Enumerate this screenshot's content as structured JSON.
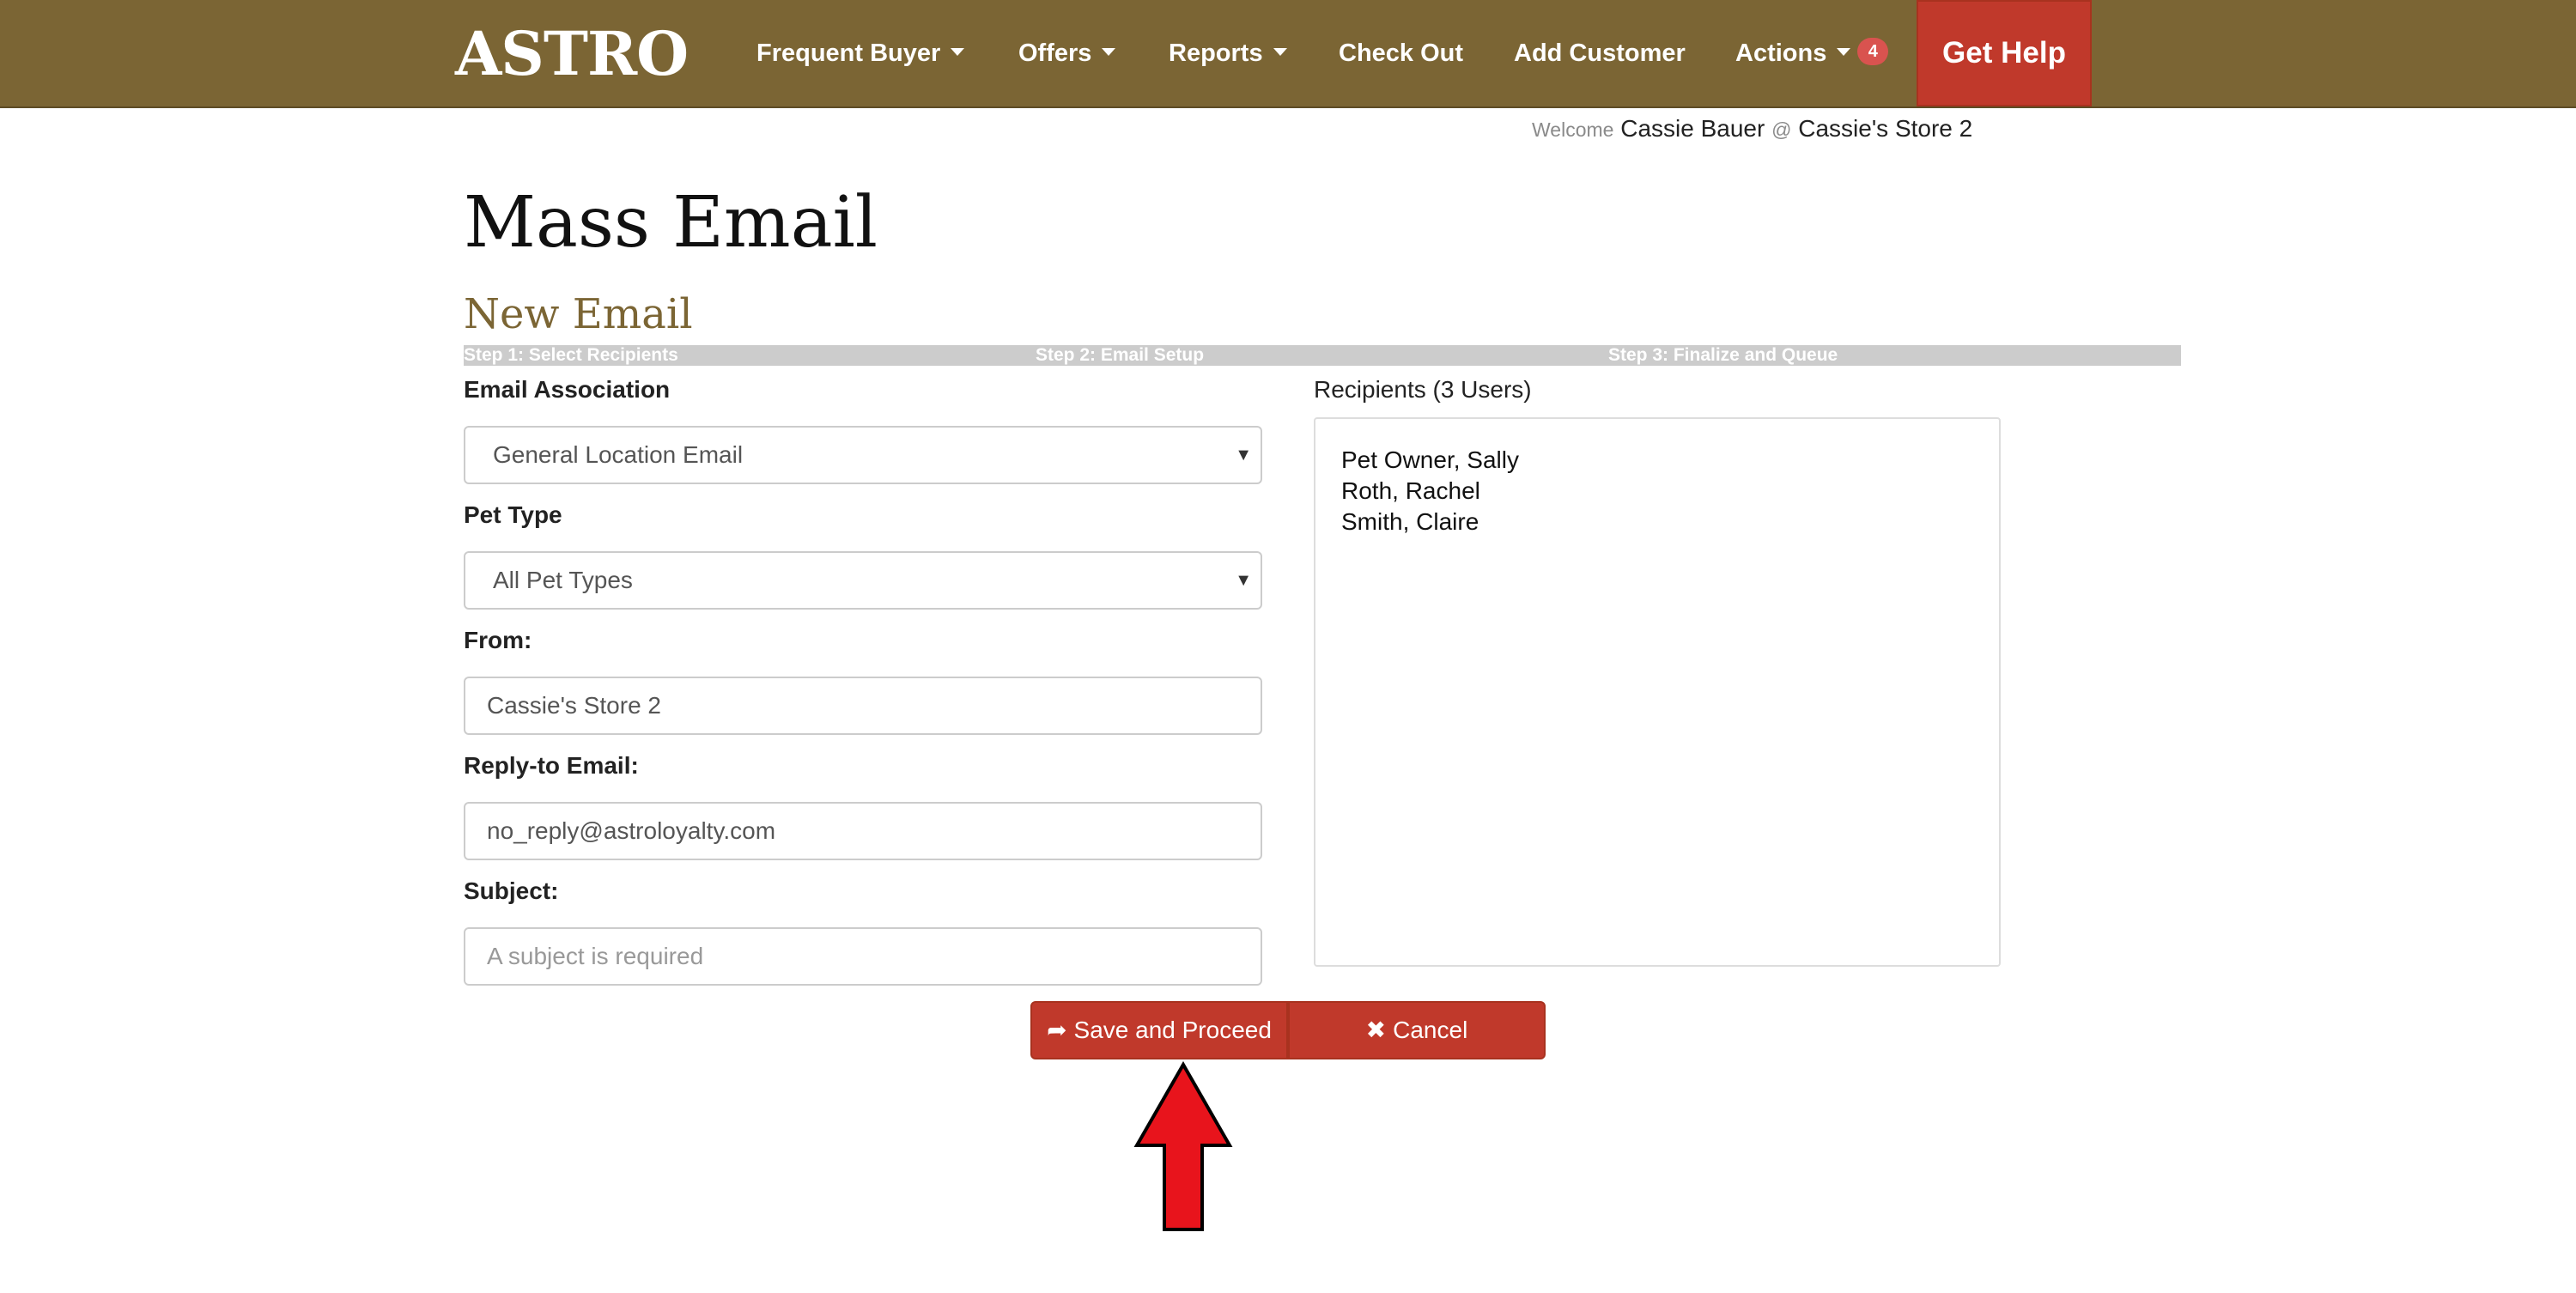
{
  "nav": {
    "brand": "ASTRO",
    "items": [
      {
        "label": "Frequent Buyer",
        "dropdown": true
      },
      {
        "label": "Offers",
        "dropdown": true
      },
      {
        "label": "Reports",
        "dropdown": true
      },
      {
        "label": "Check Out",
        "dropdown": false
      },
      {
        "label": "Add Customer",
        "dropdown": false
      },
      {
        "label": "Actions",
        "dropdown": true,
        "badge": "4"
      }
    ],
    "help_label": "Get Help",
    "colors": {
      "bar": "#7b6534",
      "help": "#c0392b",
      "badge": "#d9534f"
    }
  },
  "welcome": {
    "prefix": "Welcome",
    "user": "Cassie Bauer",
    "at": "@",
    "store": "Cassie's Store 2"
  },
  "page": {
    "title": "Mass Email",
    "subtitle": "New Email"
  },
  "steps": [
    "Step 1: Select Recipients",
    "Step 2: Email Setup",
    "Step 3: Finalize and Queue"
  ],
  "form": {
    "email_association": {
      "label": "Email Association",
      "value": "General Location Email"
    },
    "pet_type": {
      "label": "Pet Type",
      "value": "All Pet Types"
    },
    "from": {
      "label": "From:",
      "value": "Cassie's Store 2"
    },
    "reply_to": {
      "label": "Reply-to Email:",
      "value": "no_reply@astroloyalty.com"
    },
    "subject": {
      "label": "Subject:",
      "placeholder": "A subject is required"
    }
  },
  "recipients": {
    "label": "Recipients (3 Users)",
    "items": [
      "Pet Owner, Sally",
      "Roth, Rachel",
      "Smith, Claire"
    ]
  },
  "buttons": {
    "save": "Save and Proceed",
    "cancel": "Cancel",
    "save_icon": "share-arrow-icon",
    "cancel_icon": "close-icon"
  },
  "annotation": {
    "arrow_color": "#e8141c",
    "icon": "up-arrow-icon"
  }
}
